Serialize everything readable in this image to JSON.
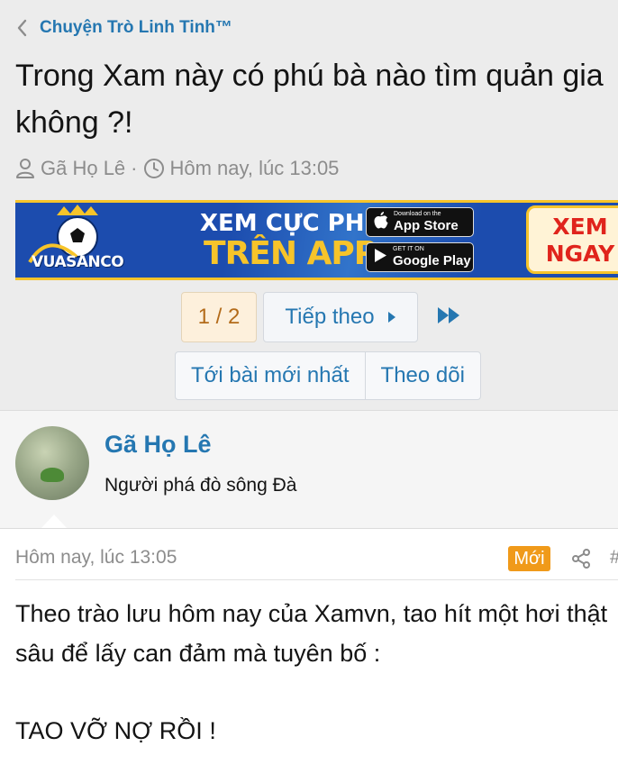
{
  "breadcrumb": {
    "label": "Chuyện Trò Linh Tinh™"
  },
  "thread": {
    "title_line1": "Trong Xam này có phú bà nào tìm quản gia",
    "title_line2": "không ?!",
    "author": "Gã Họ Lê",
    "separator": "·",
    "date": "Hôm nay, lúc 13:05"
  },
  "banner": {
    "brand": "VUASANCO",
    "headline_line1": "XEM CỰC PHÊ",
    "headline_line2": "TRÊN APP",
    "appstore_small": "Download on the",
    "appstore_big": "App Store",
    "googleplay_small": "GET IT ON",
    "googleplay_big": "Google Play",
    "cta_line1": "XEM",
    "cta_line2": "NGAY"
  },
  "pagination": {
    "current": "1 / 2",
    "next_label": "Tiếp theo"
  },
  "actions": {
    "latest_label": "Tới bài mới nhất",
    "follow_label": "Theo dõi"
  },
  "user": {
    "name": "Gã Họ Lê",
    "title": "Người phá đò sông Đà"
  },
  "post": {
    "time": "Hôm nay, lúc 13:05",
    "badge": "Mới",
    "hash": "#",
    "paragraph1": "Theo trào lưu hôm nay của Xamvn, tao hít một hơi thật sâu để lấy can đảm mà tuyên bố :",
    "paragraph2": "TAO VỠ NỢ RỒI !"
  },
  "colors": {
    "link": "#2577b1",
    "badge": "#f09a1a",
    "muted": "#8c8c8c"
  }
}
